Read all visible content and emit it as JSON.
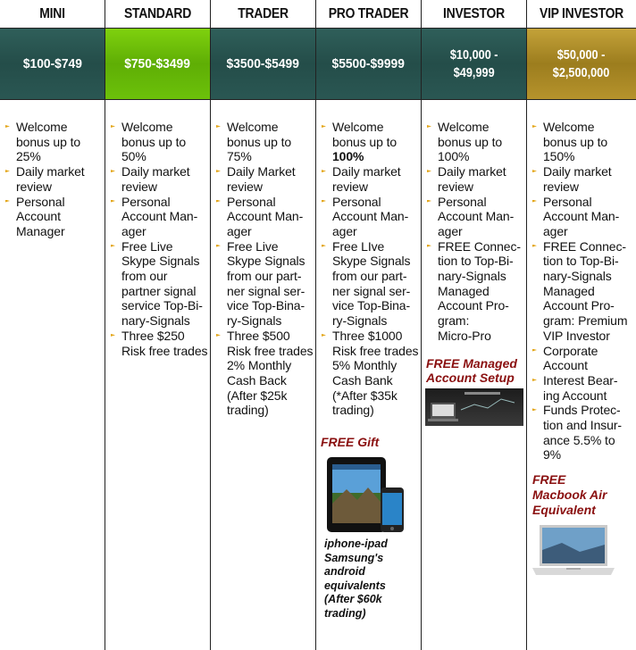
{
  "columns": [
    {
      "name": "MINI",
      "price": "$100-$749",
      "features": [
        "Welcome\nbonus up to\n25%",
        "Daily market\nreview",
        "Personal\nAccount\nManager"
      ]
    },
    {
      "name": "STANDARD",
      "price": "$750-$3499",
      "features": [
        "Welcome\nbonus up to\n50%",
        "Daily market\nreview",
        "Personal\nAccount Man-\nager",
        "Free Live\nSkype Signals\nfrom our\npartner signal\nservice Top-Bi-\nnary-Signals",
        "Three $250\nRisk free trades"
      ]
    },
    {
      "name": "TRADER",
      "price": "$3500-$5499",
      "features": [
        "Welcome\nbonus up to\n75%",
        "Daily Market\nreview",
        "Personal\nAccount Man-\nager",
        "Free Live\nSkype Signals\nfrom our part-\nner signal ser-\nvice Top-Bina-\nry-Signals",
        "Three $500\nRisk free trades\n2% Monthly\nCash Back\n(After $25k\ntrading)"
      ]
    },
    {
      "name": "PRO TRADER",
      "price": "$5500-$9999",
      "features_a": "Welcome\nbonus up to",
      "features_a_bold": "100%",
      "features": [
        "Daily market\nreview",
        "Personal\nAccount Man-\nager",
        "Free LIve\nSkype Signals\nfrom our part-\nner signal ser-\nvice Top-Bina-\nry-Signals",
        "Three $1000\nRisk free trades\n5% Monthly\nCash Bank\n(*After $35k\ntrading)"
      ],
      "promo": "FREE Gift",
      "caption": "iphone-ipad\nSamsung's\nandroid\nequivalents\n(After $60k\ntrading)"
    },
    {
      "name": "INVESTOR",
      "price_line1": "$10,000 -",
      "price_line2": "$49,999",
      "features": [
        "Welcome\nbonus up to\n100%",
        "Daily market\nreview",
        "Personal\nAccount Man-\nager",
        "FREE Connec-\ntion to Top-Bi-\nnary-Signals\nManaged\nAccount Pro-\ngram:\nMicro-Pro"
      ],
      "promo": "FREE Managed\nAccount Setup"
    },
    {
      "name": "VIP INVESTOR",
      "price_line1": "$50,000 -",
      "price_line2": "$2,500,000",
      "features": [
        "Welcome\nbonus up to\n150%",
        "Daily market\nreview",
        "Personal\nAccount Man-\nager",
        "FREE Connec-\ntion to Top-Bi-\nnary-Signals\nManaged\nAccount Pro-\ngram: Premium\nVIP Investor",
        "Corporate\nAccount",
        "Interest Bear-\ning Account",
        "Funds Protec-\ntion and Insur-\nance 5.5% to\n9%"
      ],
      "promo": "FREE\nMacbook Air\nEquivalent"
    }
  ],
  "colors": {
    "teal": "#2a5753",
    "green": "#6cc10a",
    "gold": "#b6932c",
    "promo": "#8a1010",
    "bullet": "#e3a61a"
  }
}
